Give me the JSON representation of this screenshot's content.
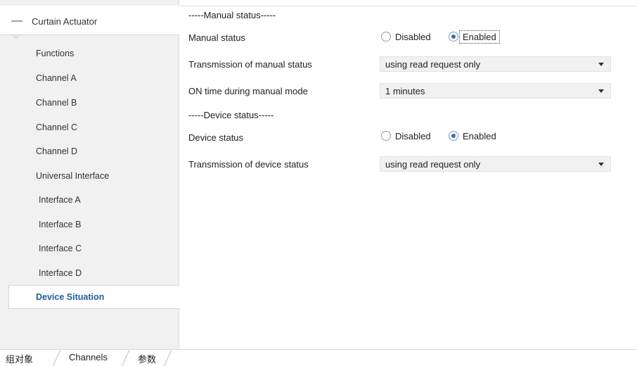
{
  "sidebar": {
    "header": {
      "icon": "minus-icon",
      "label": "Curtain Actuator"
    },
    "items": [
      {
        "label": "Functions"
      },
      {
        "label": "Channel A"
      },
      {
        "label": "Channel B"
      },
      {
        "label": "Channel C"
      },
      {
        "label": "Channel D"
      },
      {
        "label": "Universal Interface"
      },
      {
        "label": "Interface A"
      },
      {
        "label": "Interface B"
      },
      {
        "label": "Interface C"
      },
      {
        "label": "Interface D"
      }
    ],
    "selected": {
      "label": "Device Situation"
    }
  },
  "main": {
    "manual_section": {
      "title": "-----Manual status-----"
    },
    "manual_status": {
      "label": "Manual status",
      "option_disabled": "Disabled",
      "option_enabled": "Enabled",
      "selected": "Enabled"
    },
    "transmission_manual": {
      "label": "Transmission of manual status",
      "value": "using read request only"
    },
    "on_time": {
      "label": "ON time during manual mode",
      "value": "1 minutes"
    },
    "device_section": {
      "title": "-----Device status-----"
    },
    "device_status": {
      "label": "Device status",
      "option_disabled": "Disabled",
      "option_enabled": "Enabled",
      "selected": "Enabled"
    },
    "transmission_device": {
      "label": "Transmission of device status",
      "value": "using read request only"
    }
  },
  "bottom_tabs": [
    {
      "label": "组对象"
    },
    {
      "label": "Channels"
    },
    {
      "label": "参数"
    }
  ],
  "colors": {
    "selected_text": "#1f5f9a",
    "radio_fill": "#3c6ea8"
  }
}
